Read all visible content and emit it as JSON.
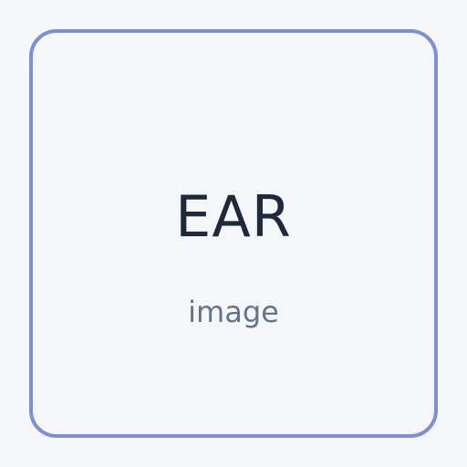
{
  "placeholder": {
    "title": "EAR",
    "subtitle": "image"
  },
  "colors": {
    "background": "#f5f6f8",
    "border": "#7b90d9",
    "title": "#1e293b",
    "subtitle": "#64748b"
  }
}
